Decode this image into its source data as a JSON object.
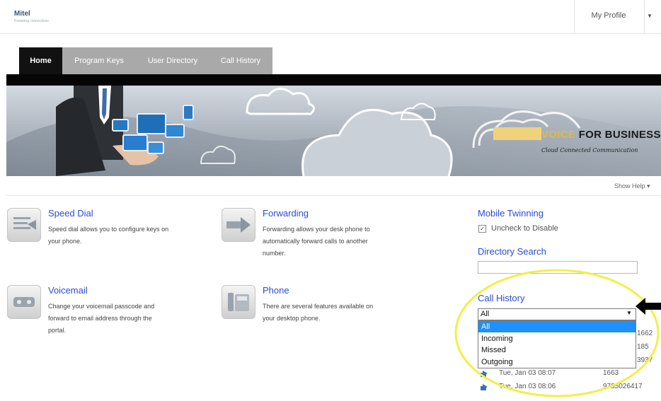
{
  "header": {
    "logo_text": "Mitel",
    "logo_tagline": "Powering connections",
    "profile_label": "My Profile"
  },
  "tabs": [
    {
      "label": "Home",
      "active": true
    },
    {
      "label": "Program Keys",
      "active": false
    },
    {
      "label": "User Directory",
      "active": false
    },
    {
      "label": "Call History",
      "active": false
    }
  ],
  "banner": {
    "brand_voice": "VOICE",
    "brand_rest": " FOR BUSINESS",
    "tagline": "Cloud Connected Communication"
  },
  "show_help": "Show Help",
  "features": [
    {
      "title": "Speed Dial",
      "desc_lines": [
        "Speed dial allows you to configure keys on",
        "your phone."
      ],
      "icon": "speed-dial-icon"
    },
    {
      "title": "Forwarding",
      "desc_lines": [
        "Forwarding allows your desk phone to",
        "automatically forward calls to another",
        "number."
      ],
      "icon": "forwarding-icon"
    },
    {
      "title": "Voicemail",
      "desc_lines": [
        "Change your voicemail passcode and",
        "forward to email address through the",
        "portal."
      ],
      "icon": "voicemail-icon"
    },
    {
      "title": "Phone",
      "desc_lines": [
        "There are several features available on",
        "your desktop phone."
      ],
      "icon": "phone-icon"
    }
  ],
  "right_panel": {
    "mobile_twinning_title": "Mobile Twinning",
    "uncheck_label": "Uncheck to Disable",
    "mobile_twinning_checked": true,
    "directory_search_title": "Directory Search",
    "directory_search_value": "",
    "call_history_title": "Call History",
    "filter_selected": "All",
    "filter_options": [
      "All",
      "Incoming",
      "Missed",
      "Outgoing"
    ],
    "hidden_numbers": [
      "1662",
      "185",
      "3937"
    ],
    "history_rows": [
      {
        "time": "Tue, Jan 03 08:07",
        "number": "1663"
      },
      {
        "time": "Tue, Jan 03 08:06",
        "number": "9785026417"
      }
    ]
  },
  "colors": {
    "link_blue": "#2b4bd6",
    "highlight_yellow": "#f2ef4a",
    "selected_option": "#1e90ff",
    "brand_gold": "#e0b84a"
  }
}
